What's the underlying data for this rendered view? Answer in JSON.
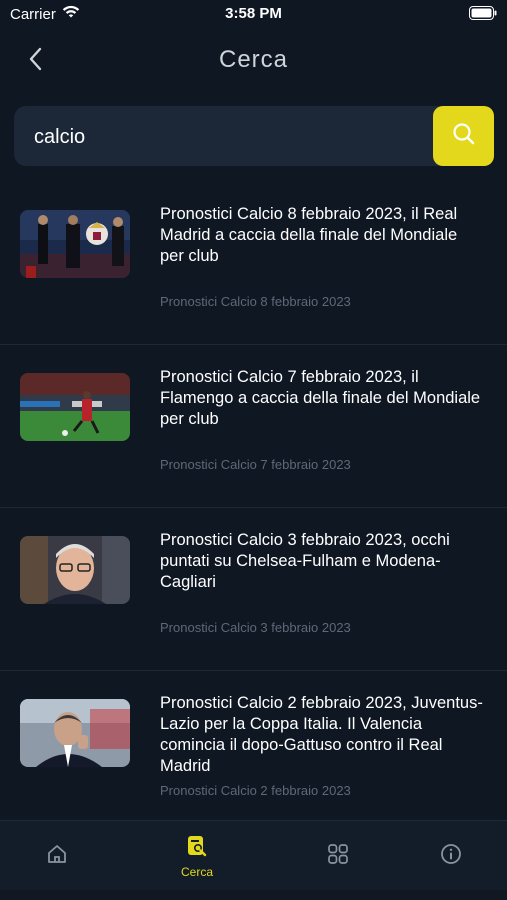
{
  "status": {
    "carrier": "Carrier",
    "time": "3:58 PM"
  },
  "header": {
    "title": "Cerca"
  },
  "search": {
    "value": "calcio",
    "placeholder": ""
  },
  "results": [
    {
      "title": "Pronostici Calcio 8 febbraio 2023, il Real Madrid a caccia della finale del Mondiale per club",
      "date": "Pronostici Calcio 8 febbraio 2023"
    },
    {
      "title": "Pronostici Calcio 7 febbraio 2023, il Flamengo a caccia della finale del Mondiale per club",
      "date": "Pronostici Calcio 7 febbraio 2023"
    },
    {
      "title": "Pronostici Calcio 3 febbraio 2023, occhi puntati su Chelsea-Fulham e Modena-Cagliari",
      "date": "Pronostici Calcio 3 febbraio 2023"
    },
    {
      "title": "Pronostici Calcio 2 febbraio 2023, Juventus-Lazio per la Coppa Italia. Il Valencia comincia il dopo-Gattuso contro il Real Madrid",
      "date": "Pronostici Calcio 2 febbraio 2023"
    }
  ],
  "tabs": {
    "active_label": "Cerca"
  },
  "colors": {
    "accent": "#e3d81b",
    "background": "#0f1723",
    "field": "#1c2737"
  },
  "icons": [
    "wifi-icon",
    "battery-icon",
    "back-icon",
    "search-icon",
    "home-icon",
    "search-doc-icon",
    "grid-icon",
    "info-icon"
  ]
}
